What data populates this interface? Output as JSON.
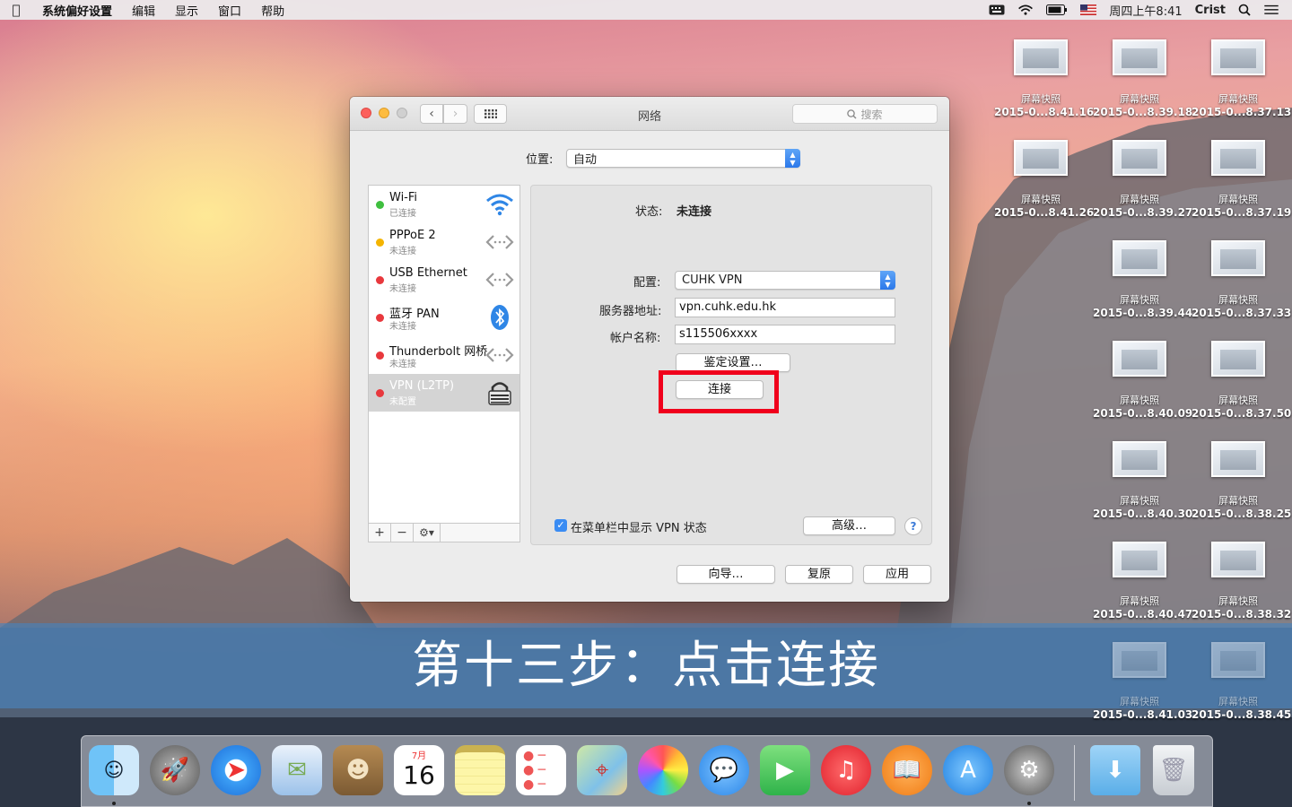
{
  "menubar": {
    "app": "系统偏好设置",
    "items": [
      "编辑",
      "显示",
      "窗口",
      "帮助"
    ],
    "clock": "周四上午8:41",
    "user": "Crist"
  },
  "desktop": {
    "icons": [
      {
        "l1": "屏幕快照",
        "l2": "2015-0...8.41.16"
      },
      {
        "l1": "屏幕快照",
        "l2": "2015-0...8.39.18"
      },
      {
        "l1": "屏幕快照",
        "l2": "2015-0...8.37.13"
      },
      {
        "l1": "屏幕快照",
        "l2": "2015-0...8.41.26"
      },
      {
        "l1": "屏幕快照",
        "l2": "2015-0...8.39.27"
      },
      {
        "l1": "屏幕快照",
        "l2": "2015-0...8.37.19"
      },
      {
        "l1": "屏幕快照",
        "l2": "2015-0...8.39.44"
      },
      {
        "l1": "屏幕快照",
        "l2": "2015-0...8.37.33"
      },
      {
        "l1": "屏幕快照",
        "l2": "2015-0...8.40.09"
      },
      {
        "l1": "屏幕快照",
        "l2": "2015-0...8.37.50"
      },
      {
        "l1": "屏幕快照",
        "l2": "2015-0...8.40.30"
      },
      {
        "l1": "屏幕快照",
        "l2": "2015-0...8.38.25"
      },
      {
        "l1": "屏幕快照",
        "l2": "2015-0...8.40.47"
      },
      {
        "l1": "屏幕快照",
        "l2": "2015-0...8.38.32"
      },
      {
        "l1": "屏幕快照",
        "l2": "2015-0...8.41.03"
      },
      {
        "l1": "屏幕快照",
        "l2": "2015-0...8.38.45"
      }
    ]
  },
  "window": {
    "title": "网络",
    "search_placeholder": "搜索",
    "location_label": "位置:",
    "location_value": "自动",
    "services": [
      {
        "name": "Wi-Fi",
        "status": "已连接",
        "dot": "#3fbf3f",
        "icon": "wifi-icon"
      },
      {
        "name": "PPPoE 2",
        "status": "未连接",
        "dot": "#f4b400",
        "icon": "network-arrows-icon"
      },
      {
        "name": "USB Ethernet",
        "status": "未连接",
        "dot": "#e8383d",
        "icon": "network-arrows-icon"
      },
      {
        "name": "蓝牙 PAN",
        "status": "未连接",
        "dot": "#e8383d",
        "icon": "bluetooth-icon"
      },
      {
        "name": "Thunderbolt 网桥",
        "status": "未连接",
        "dot": "#e8383d",
        "icon": "network-arrows-icon"
      },
      {
        "name": "VPN (L2TP)",
        "status": "未配置",
        "dot": "#e8383d",
        "icon": "vpn-lock-icon"
      }
    ],
    "tools": {
      "add": "+",
      "remove": "−",
      "gear": "⚙▾"
    },
    "detail": {
      "status_label": "状态:",
      "status_value": "未连接",
      "config_label": "配置:",
      "config_value": "CUHK VPN",
      "server_label": "服务器地址:",
      "server_value": "vpn.cuhk.edu.hk",
      "account_label": "帐户名称:",
      "account_value": "s115506xxxx",
      "auth_button": "鉴定设置…",
      "connect_button": "连接",
      "show_vpn_label": "在菜单栏中显示 VPN 状态",
      "show_vpn_checked": true,
      "advanced_button": "高级…",
      "help": "?"
    },
    "footer": {
      "assistant": "向导…",
      "revert": "复原",
      "apply": "应用"
    }
  },
  "banner": {
    "text": "第十三步：点击连接"
  },
  "dock": {
    "calendar_month": "7月",
    "calendar_day": "16",
    "apps": [
      "finder-icon",
      "launchpad-icon",
      "safari-icon",
      "mail-icon",
      "contacts-icon",
      "calendar-icon",
      "notes-icon",
      "reminders-icon",
      "maps-icon",
      "photos-icon",
      "messages-icon",
      "facetime-icon",
      "itunes-icon",
      "ibooks-icon",
      "app-store-icon",
      "system-preferences-icon",
      "downloads-folder-icon",
      "trash-icon"
    ]
  }
}
